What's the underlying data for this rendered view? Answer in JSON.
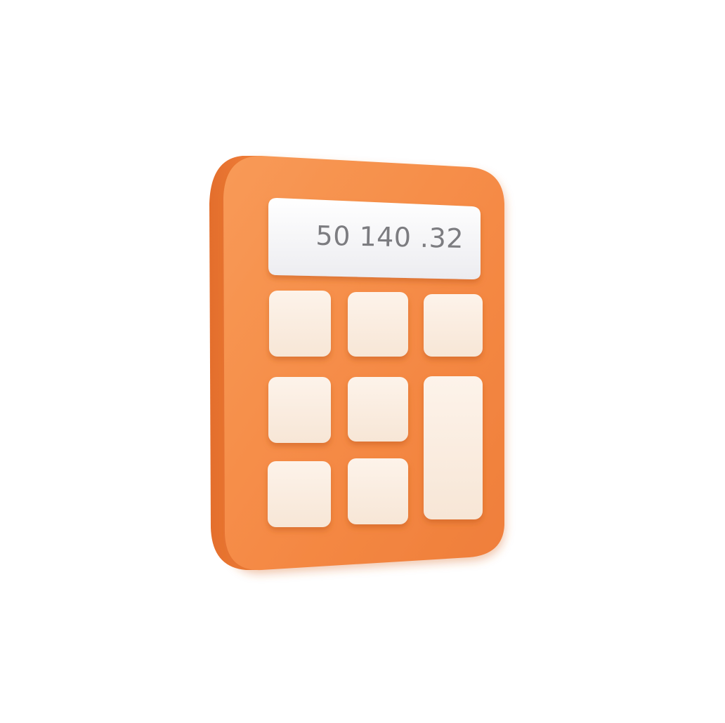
{
  "calculator": {
    "display_value": "50 140 .32",
    "colors": {
      "body": "#f58a45",
      "body_shadow": "#e0702e",
      "display": "#f5f5f7",
      "key": "#fbefe4",
      "display_text": "#7c7c80",
      "background": "#ffffff"
    },
    "keys": [
      {
        "name": "key-row1-col1",
        "icon": "blank-key"
      },
      {
        "name": "key-row1-col2",
        "icon": "blank-key"
      },
      {
        "name": "key-row1-col3",
        "icon": "blank-key"
      },
      {
        "name": "key-row2-col1",
        "icon": "blank-key"
      },
      {
        "name": "key-row2-col2",
        "icon": "blank-key"
      },
      {
        "name": "key-tall",
        "icon": "blank-key"
      },
      {
        "name": "key-row3-col1",
        "icon": "blank-key"
      },
      {
        "name": "key-row3-col2",
        "icon": "blank-key"
      }
    ]
  }
}
